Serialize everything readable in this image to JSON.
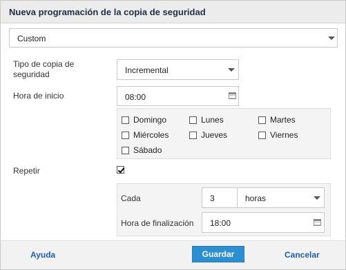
{
  "dialog": {
    "title": "Nueva programación de la copia de seguridad"
  },
  "schedule_preset": {
    "value": "Custom"
  },
  "backup_type": {
    "label": "Tipo de copia de seguridad",
    "value": "Incremental"
  },
  "start_time": {
    "label": "Hora de inicio",
    "value": "08:00"
  },
  "days": [
    {
      "label": "Domingo",
      "checked": false
    },
    {
      "label": "Lunes",
      "checked": false
    },
    {
      "label": "Martes",
      "checked": false
    },
    {
      "label": "Miércoles",
      "checked": false
    },
    {
      "label": "Jueves",
      "checked": false
    },
    {
      "label": "Viernes",
      "checked": false
    },
    {
      "label": "Sábado",
      "checked": false
    }
  ],
  "repeat": {
    "label": "Repetir",
    "checked": true,
    "every_label": "Cada",
    "every_value": "3",
    "unit": "horas",
    "end_label": "Hora de finalización",
    "end_value": "18:00"
  },
  "footer": {
    "help": "Ayuda",
    "save": "Guardar",
    "cancel": "Cancelar"
  },
  "colors": {
    "accent": "#2c8fd1",
    "link": "#1f5fa8",
    "title_text": "#1d2d44"
  }
}
